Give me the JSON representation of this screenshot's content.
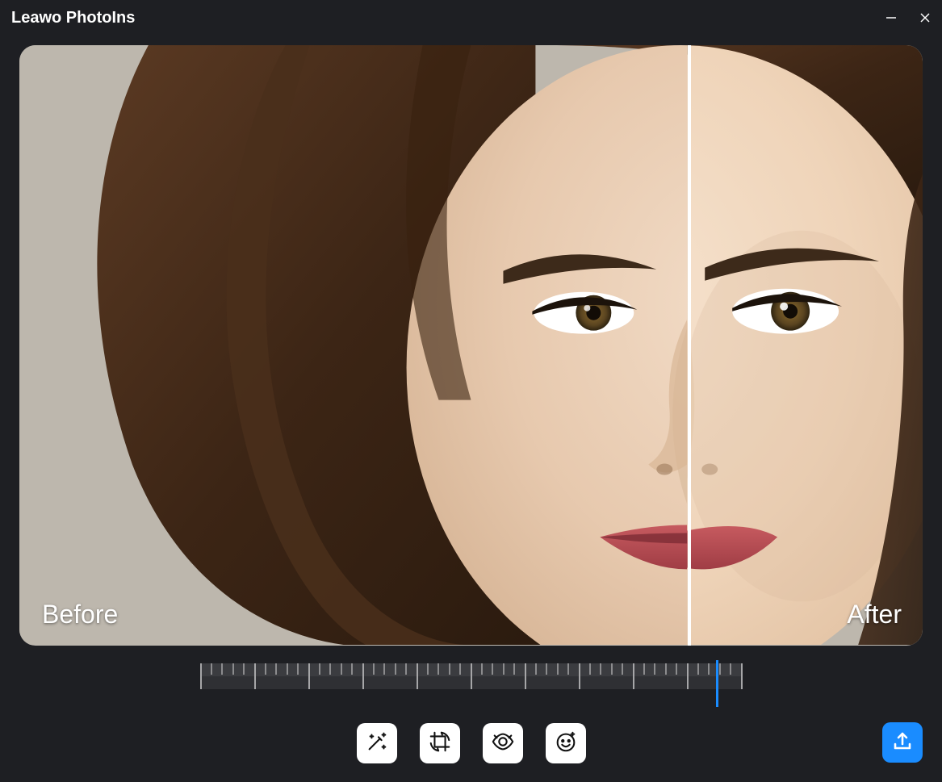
{
  "app": {
    "title": "Leawo PhotoIns"
  },
  "preview": {
    "before_label": "Before",
    "after_label": "After",
    "split_position_percent": 74
  },
  "ruler": {
    "needle_position_percent": 95.5
  },
  "tools": [
    {
      "name": "auto-enhance"
    },
    {
      "name": "crop-rotate"
    },
    {
      "name": "eye-enhance"
    },
    {
      "name": "face-enhance"
    }
  ],
  "export": {
    "name": "export"
  },
  "colors": {
    "background": "#1e1f23",
    "accent": "#1a8cff",
    "tool_bg": "#ffffff"
  }
}
